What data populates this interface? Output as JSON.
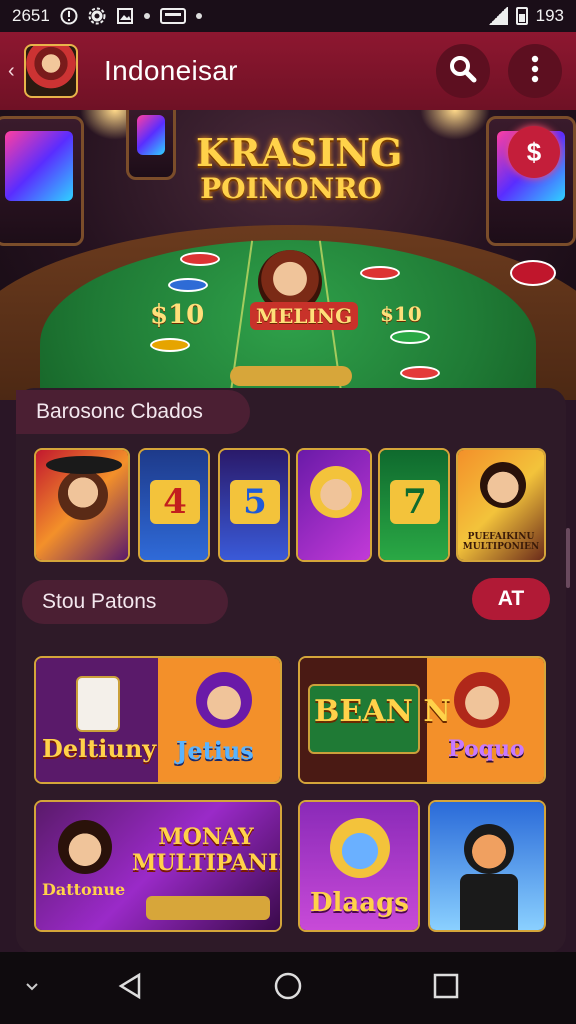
{
  "status_bar": {
    "time": "2651",
    "battery_text": "193"
  },
  "app_bar": {
    "title": "Indoneisar"
  },
  "hero": {
    "title_line1": "KRASING",
    "title_line2": "POINONRO",
    "badge_text": "$",
    "felt_left": "$10",
    "felt_center": "MELING",
    "felt_right": "$10"
  },
  "sections": {
    "section1": {
      "heading": "Barosonc Cbados"
    },
    "section2": {
      "heading": "Stou Patons",
      "filter_label": "AT"
    }
  },
  "section1_tiles": [
    {
      "name": "hat-woman-game",
      "text": ""
    },
    {
      "name": "slot-4-game",
      "text": "4"
    },
    {
      "name": "slot-5-game",
      "text": "5"
    },
    {
      "name": "blonde-woman-game",
      "text": ""
    },
    {
      "name": "slot-7-game",
      "text": "7"
    },
    {
      "name": "multiplier-woman-game",
      "text": "PUEFAIKINU MULTIPONIEN"
    }
  ],
  "section2_tiles": [
    {
      "name": "dollumy-game",
      "text_a": "Deltiuny",
      "text_b": "Jetius"
    },
    {
      "name": "beann-game",
      "text_a": "BEAN N",
      "text_b": "Poquo"
    },
    {
      "name": "monay-game",
      "text_a": "MONAY MULTIPANIR",
      "text_b": "Dattonue"
    },
    {
      "name": "dlaags-game",
      "text_a": "Dlaags",
      "text_b": ""
    }
  ],
  "colors": {
    "accent": "#8e1730",
    "panel": "#2e1a28",
    "gold": "#ffd24a",
    "badge": "#b11a36"
  },
  "icons": {
    "search": "search-icon",
    "more": "more-vert-icon",
    "back": "nav-back-icon",
    "home": "nav-home-icon",
    "recents": "nav-recents-icon"
  }
}
